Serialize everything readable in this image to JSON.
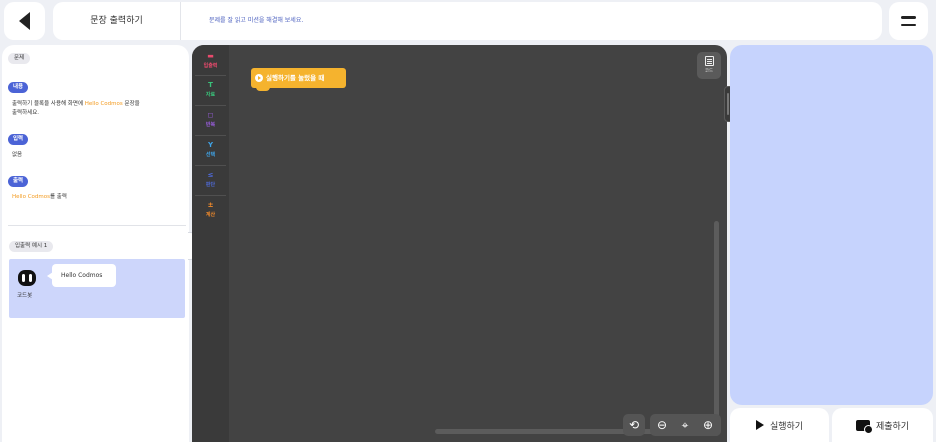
{
  "header": {
    "title": "문장 출력하기",
    "subtitle": "문제를 잘 읽고 미션을 해결해 보세요."
  },
  "problem": {
    "tag": "문제",
    "content_label": "내용",
    "content_text_1": "출력하기 블록을 사용해 화면에 ",
    "content_highlight": "Hello Codmos",
    "content_text_2": " 문장을",
    "content_text_3": "출력하세요.",
    "input_label": "입력",
    "input_text": "없음",
    "output_label": "출력",
    "output_highlight": "Hello Codmos",
    "output_text": "를 출력"
  },
  "example": {
    "tag": "입출력 예시 1",
    "speaker": "코드봇",
    "bubble_text": "Hello Codmos"
  },
  "categories": [
    {
      "label": "입출력",
      "icon": "io-icon",
      "color": "#e84a6c"
    },
    {
      "label": "자료",
      "icon": "data-icon",
      "color": "#39c27a"
    },
    {
      "label": "반복",
      "icon": "loop-icon",
      "color": "#9b5ee0"
    },
    {
      "label": "선택",
      "icon": "select-icon",
      "color": "#3fa4e8"
    },
    {
      "label": "판단",
      "icon": "judge-icon",
      "color": "#4f6ad8"
    },
    {
      "label": "계산",
      "icon": "calc-icon",
      "color": "#f08a2b"
    }
  ],
  "workspace": {
    "start_block_label": "실행하기를 눌렀을 때",
    "code_button_label": "코드"
  },
  "actions": {
    "run_label": "실행하기",
    "submit_label": "제출하기"
  }
}
